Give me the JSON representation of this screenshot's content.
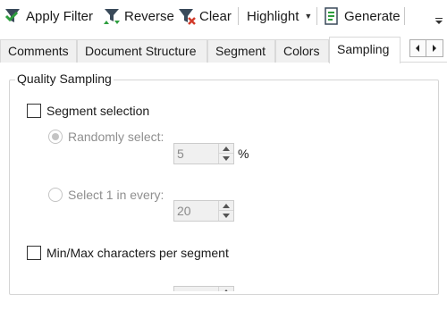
{
  "toolbar": {
    "apply_filter_label": "Apply Filter",
    "reverse_label": "Reverse",
    "clear_label": "Clear",
    "highlight_label": "Highlight",
    "generate_label": "Generate",
    "icons": {
      "apply_filter": "funnel-check-icon",
      "reverse": "funnel-reverse-icon",
      "clear": "funnel-clear-icon",
      "generate": "document-generate-icon",
      "overflow": "toolbar-overflow-icon"
    }
  },
  "tabs": [
    {
      "label": "Comments",
      "active": false
    },
    {
      "label": "Document Structure",
      "active": false
    },
    {
      "label": "Segment",
      "active": false
    },
    {
      "label": "Colors",
      "active": false
    },
    {
      "label": "Sampling",
      "active": true
    }
  ],
  "sampling": {
    "group_title": "Quality Sampling",
    "segment_selection": {
      "label": "Segment selection",
      "checked": false
    },
    "random_select": {
      "label": "Randomly select:",
      "selected": true,
      "enabled": false,
      "value": "5",
      "unit": "%"
    },
    "select_one_in": {
      "label": "Select 1 in every:",
      "selected": false,
      "enabled": false,
      "value": "20"
    },
    "minmax": {
      "label": "Min/Max characters per segment",
      "checked": false
    }
  },
  "colors": {
    "funnel_dark": "#3a4a5a",
    "check_green": "#2e9e3e",
    "clear_red": "#d23b2a",
    "disabled_text": "#8f8f8f"
  }
}
